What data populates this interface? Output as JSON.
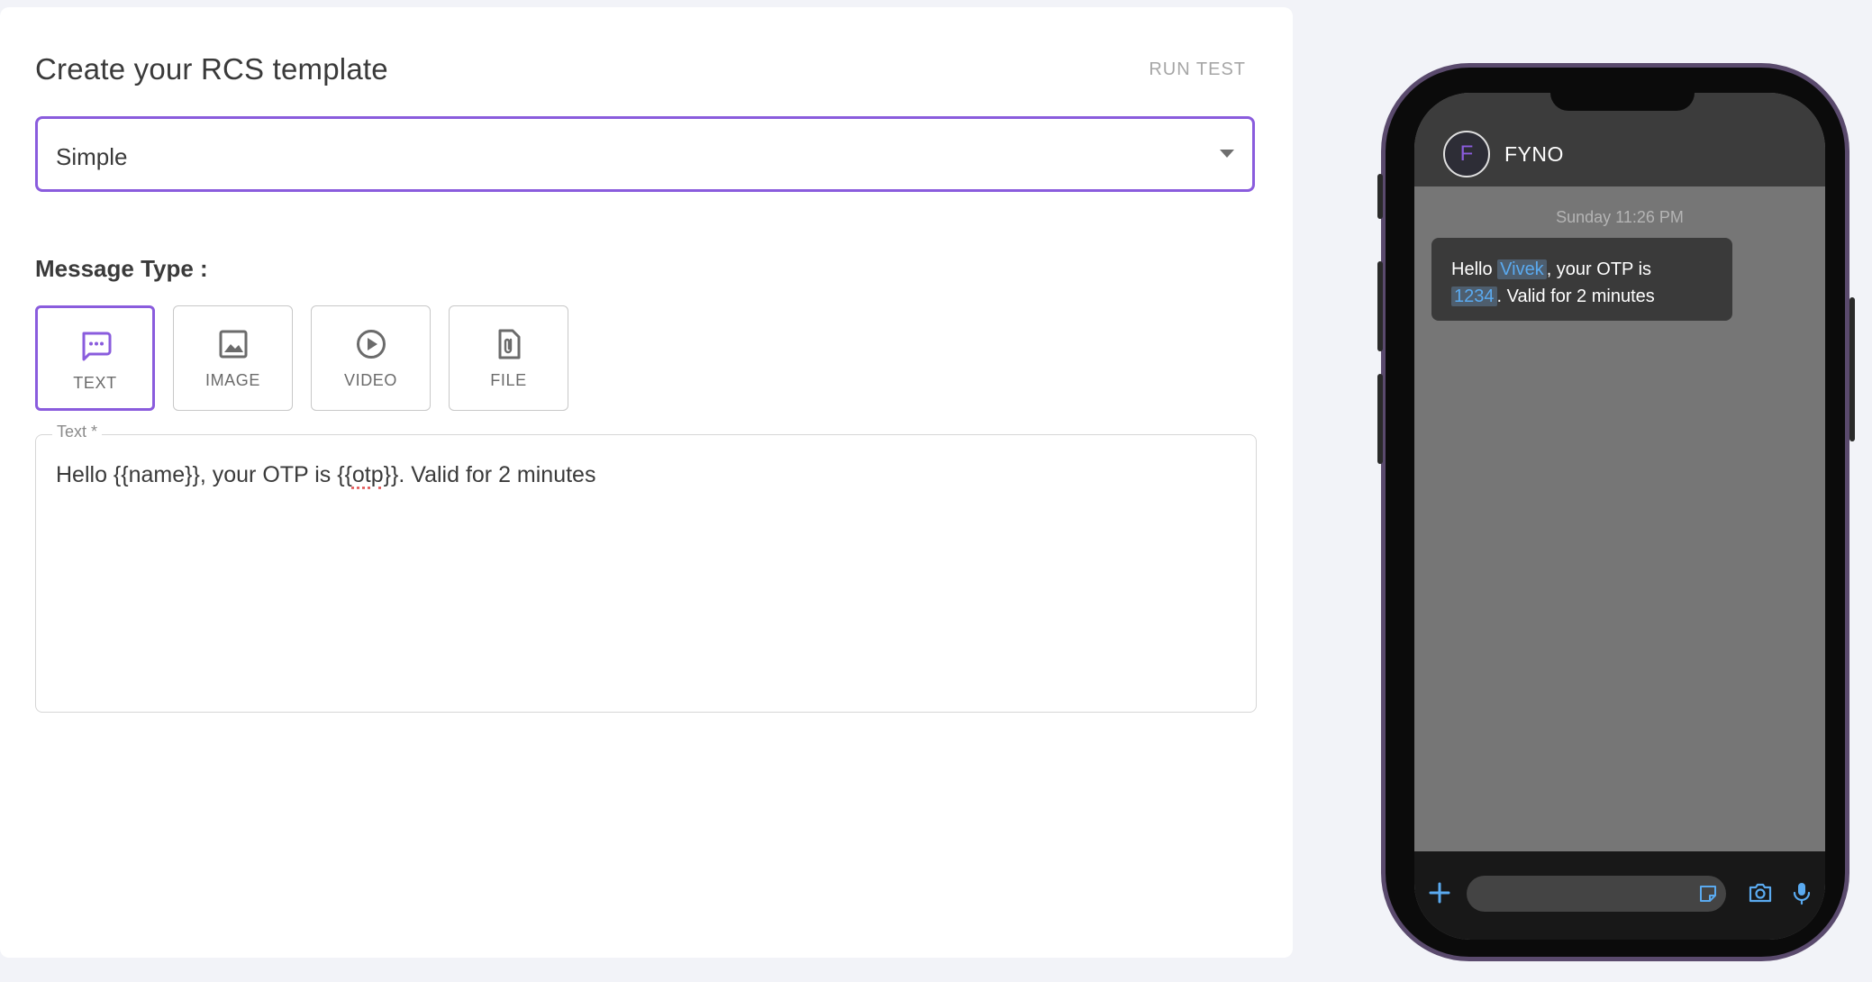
{
  "editor": {
    "title": "Create your RCS template",
    "run_test_label": "RUN TEST",
    "template_type": {
      "selected": "Simple"
    },
    "message_type_label": "Message Type :",
    "message_types": [
      {
        "label": "TEXT",
        "icon": "chat-bubble-icon",
        "active": true
      },
      {
        "label": "IMAGE",
        "icon": "image-icon",
        "active": false
      },
      {
        "label": "VIDEO",
        "icon": "play-circle-icon",
        "active": false
      },
      {
        "label": "FILE",
        "icon": "attachment-file-icon",
        "active": false
      }
    ],
    "text_field": {
      "label": "Text *",
      "value_before": "Hello {{name}}, your OTP is {{",
      "value_spell": "otp",
      "value_after": "}}. Valid for 2 minutes"
    }
  },
  "preview": {
    "sender_initial": "F",
    "sender_name": "FYNO",
    "timestamp": "Sunday 11:26 PM",
    "message": {
      "part1": "Hello ",
      "var1": "Vivek",
      "part2": ", your OTP is",
      "var2": "1234",
      "part3": ". Valid for 2 minutes"
    }
  },
  "colors": {
    "accent": "#8a5cdd",
    "variable_highlight": "#5aaaf0",
    "page_bg": "#f2f3f8"
  }
}
